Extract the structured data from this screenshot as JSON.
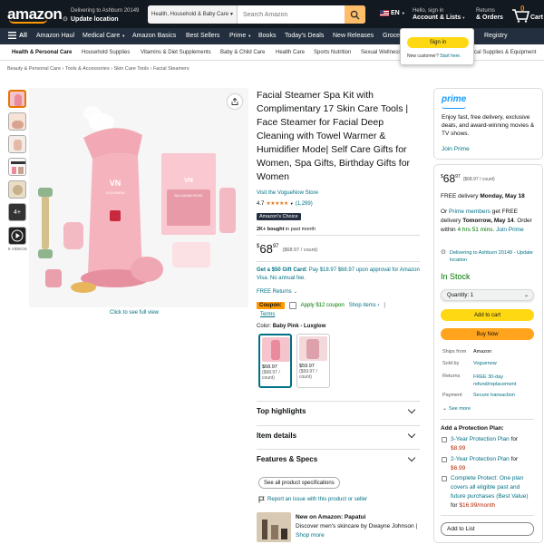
{
  "header": {
    "logo": "amazon",
    "deliver_line1": "Delivering to Ashburn 20149",
    "deliver_line2": "Update location",
    "search_category": "Health, Household & Baby Care",
    "search_placeholder": "Search Amazon",
    "lang": "EN",
    "account_line1": "Hello, sign in",
    "account_line2": "Account & Lists",
    "orders_line1": "Returns",
    "orders_line2": "& Orders",
    "cart_count": "0",
    "cart_label": "Cart"
  },
  "signin_popup": {
    "button": "Sign in",
    "new_customer": "New customer?",
    "start_here": "Start here."
  },
  "nav2": {
    "all": "All",
    "items": [
      "Amazon Haul",
      "Medical Care",
      "Amazon Basics",
      "Best Sellers",
      "Prime",
      "Books",
      "Today's Deals",
      "New Releases",
      "Groce",
      "Registry"
    ]
  },
  "nav3": {
    "items": [
      "Health & Personal Care",
      "Household Supplies",
      "Vitamins & Diet Supplements",
      "Baby & Child Care",
      "Health Care",
      "Sports Nutrition",
      "Sexual Wellness",
      "Medical Supplies & Equipment"
    ]
  },
  "breadcrumb": [
    "Beauty & Personal Care",
    "Tools & Accessories",
    "Skin Care Tools",
    "Facial Steamers"
  ],
  "gallery": {
    "more_count": "4+",
    "videos_label": "6 VIDEOS",
    "click_full": "Click to see full view",
    "brand_text": "VOGUENOW",
    "product_label": "BULGARIAN ROSE"
  },
  "product": {
    "title": "Facial Steamer Spa Kit with Complimentary 17 Skin Care Tools | Face Steamer for Facial Deep Cleaning with Towel Warmer & Humidifier Mode| Self Care Gifts for Women, Spa Gifts, Birthday Gifts for Women",
    "store_link": "Visit the VogueNow Store",
    "rating": "4.7",
    "rating_count": "(1,299)",
    "badge": "Amazon's Choice",
    "bought": "2K+ bought",
    "bought_suffix": "in past month",
    "price_whole": "68",
    "price_fraction": "97",
    "price_per": "($68.97 / count)",
    "gift_card_bold": "Get a $50 Gift Card:",
    "gift_card_text": "Pay $18.97 $68.97 upon approval for Amazon Visa. No annual fee.",
    "free_returns": "FREE Returns",
    "coupon_label": "Coupon:",
    "coupon_apply": "Apply $12 coupon",
    "coupon_shop": "Shop items ›",
    "coupon_terms": "Terms",
    "color_label": "Color:",
    "color_value": "Baby Pink - Luxglow",
    "swatches": [
      {
        "price": "$68.97",
        "per": "($68.97 / count)"
      },
      {
        "price": "$59.97",
        "per": "($59.97 / count)"
      }
    ],
    "sections": [
      "Top highlights",
      "Item details",
      "Features & Specs"
    ],
    "see_all_specs": "See all product specifications",
    "report_issue": "Report an issue with this product or seller",
    "ad_title": "New on Amazon: Papatui",
    "ad_text": "Discover men's skincare by Dwayne Johnson",
    "ad_shop": "Shop more"
  },
  "buybox": {
    "prime_logo": "prime",
    "prime_text": "Enjoy fast, free delivery, exclusive deals, and award-winning movies & TV shows.",
    "join_prime": "Join Prime",
    "price_whole": "68",
    "price_fraction": "97",
    "price_per": "($68.97 / count)",
    "free_delivery": "FREE delivery",
    "free_delivery_date": "Monday, May 18",
    "or_text": "Or",
    "prime_members": "Prime members",
    "fastest_text": "get FREE delivery",
    "fastest_date": "Tomorrow, May 14",
    "order_within": "Order within",
    "order_time": "4 hrs 51 mins.",
    "join_prime_2": "Join Prime",
    "deliver_to": "Delivering to Ashburn 20149 - Update location",
    "in_stock": "In Stock",
    "quantity_label": "Quantity:",
    "quantity_value": "1",
    "add_to_cart": "Add to cart",
    "buy_now": "Buy Now",
    "details": [
      {
        "label": "Ships from",
        "value": "Amazon"
      },
      {
        "label": "Sold by",
        "value": "Voguenow"
      },
      {
        "label": "Returns",
        "value": "FREE 30-day refund/replacement"
      },
      {
        "label": "Payment",
        "value": "Secure transaction"
      }
    ],
    "see_more": "See more",
    "protection_title": "Add a Protection Plan:",
    "plans": [
      {
        "name": "3-Year Protection Plan",
        "for": "for",
        "price": "$8.99"
      },
      {
        "name": "2-Year Protection Plan",
        "for": "for",
        "price": "$6.99"
      },
      {
        "name": "Complete Protect: One plan covers all eligible past and future purchases (Best Value)",
        "for": "for",
        "price": "$16.99/month"
      }
    ],
    "add_to_list": "Add to List"
  },
  "colors": {
    "header_bg": "#131921",
    "nav_bg": "#232f3e",
    "accent_orange": "#ff9900",
    "button_yellow": "#ffd814",
    "button_orange": "#ffa41c",
    "link": "#007185",
    "price_red": "#cc0c39",
    "stock_green": "#007600"
  }
}
